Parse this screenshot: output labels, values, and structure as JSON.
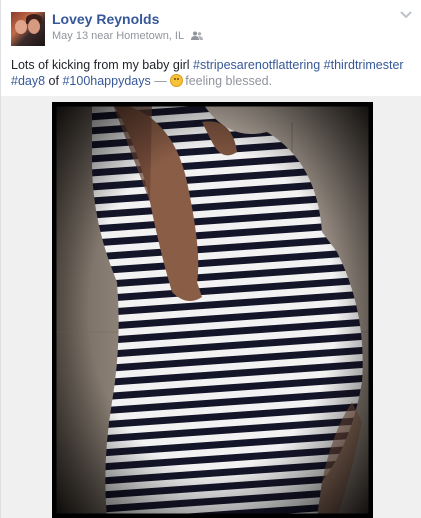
{
  "post": {
    "author": "Lovey Reynolds",
    "date": "May 13",
    "location_prefix": "near",
    "location": "Hometown, IL",
    "text_intro": "Lots of kicking from my baby girl",
    "hashtags": [
      "#stripesarenotflattering",
      "#thirdtrimester",
      "#day8",
      "#100happydays"
    ],
    "text_of": "of",
    "text_dash": "—",
    "feeling": "feeling blessed."
  },
  "icons": {
    "audience": "friends-icon",
    "options": "chevron-down-icon",
    "feeling": "smiling-emoji-icon"
  },
  "colors": {
    "link": "#365899",
    "meta": "#90949c",
    "photo_bg": "#0b0b0b"
  }
}
